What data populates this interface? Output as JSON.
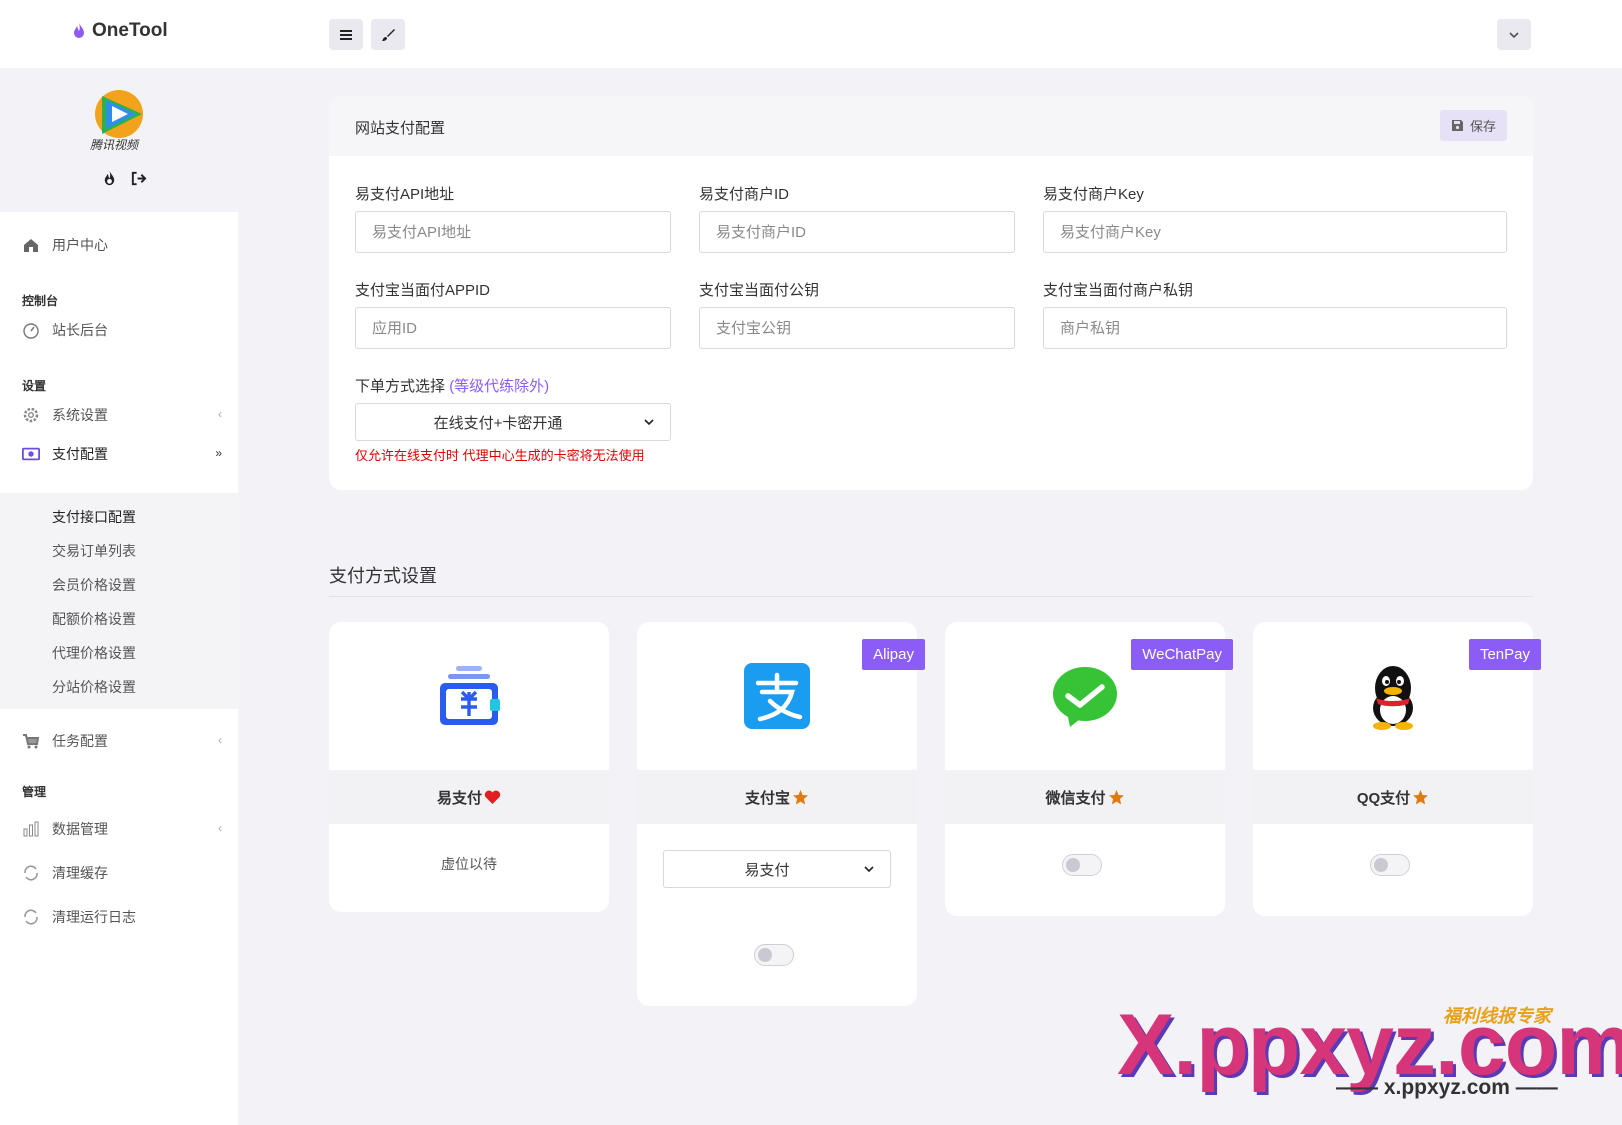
{
  "app": {
    "name": "OneTool"
  },
  "topbar": {
    "menu_icon": "bars-icon",
    "theme_icon": "brush-icon",
    "dropdown_icon": "chevron-down-icon"
  },
  "sidebar": {
    "avatar_caption": "腾讯视频",
    "items": [
      {
        "label": "用户中心",
        "icon": "home-icon"
      },
      {
        "label": "站长后台",
        "icon": "dashboard-icon"
      },
      {
        "label": "系统设置",
        "icon": "gear-icon"
      },
      {
        "label": "支付配置",
        "icon": "money-icon"
      },
      {
        "label": "任务配置",
        "icon": "cart-icon"
      },
      {
        "label": "数据管理",
        "icon": "bar-chart-icon"
      },
      {
        "label": "清理缓存",
        "icon": "refresh-icon"
      },
      {
        "label": "清理运行日志",
        "icon": "refresh-icon"
      }
    ],
    "sections": [
      "控制台",
      "设置",
      "管理"
    ],
    "submenu": [
      "支付接口配置",
      "交易订单列表",
      "会员价格设置",
      "配额价格设置",
      "代理价格设置",
      "分站价格设置"
    ]
  },
  "config": {
    "title": "网站支付配置",
    "save_label": "保存",
    "fields": [
      {
        "label": "易支付API地址",
        "placeholder": "易支付API地址"
      },
      {
        "label": "易支付商户ID",
        "placeholder": "易支付商户ID"
      },
      {
        "label": "易支付商户Key",
        "placeholder": "易支付商户Key"
      },
      {
        "label": "支付宝当面付APPID",
        "placeholder": "应用ID"
      },
      {
        "label": "支付宝当面付公钥",
        "placeholder": "支付宝公钥"
      },
      {
        "label": "支付宝当面付商户私钥",
        "placeholder": "商户私钥"
      }
    ],
    "order_mode_label": "下单方式选择",
    "order_mode_hint": "(等级代练除外)",
    "order_mode_value": "在线支付+卡密开通",
    "warning": "仅允许在线支付时 代理中心生成的卡密将无法使用"
  },
  "methods": {
    "title": "支付方式设置",
    "cards": [
      {
        "name": "易支付",
        "badge_icon": "heart-icon",
        "ribbon": "",
        "body_text": "虚位以待"
      },
      {
        "name": "支付宝",
        "badge_icon": "star-icon",
        "ribbon": "Alipay",
        "select_value": "易支付"
      },
      {
        "name": "微信支付",
        "badge_icon": "star-icon",
        "ribbon": "WeChatPay"
      },
      {
        "name": "QQ支付",
        "badge_icon": "star-icon",
        "ribbon": "TenPay"
      }
    ]
  },
  "watermark": {
    "big": "X.ppxyz.com",
    "small": "—— x.ppxyz.com ——",
    "top": "福利线报专家"
  },
  "colors": {
    "accent": "#8b5cf6",
    "warning": "#e00000",
    "star": "#e07b14",
    "heart": "#e02020"
  }
}
